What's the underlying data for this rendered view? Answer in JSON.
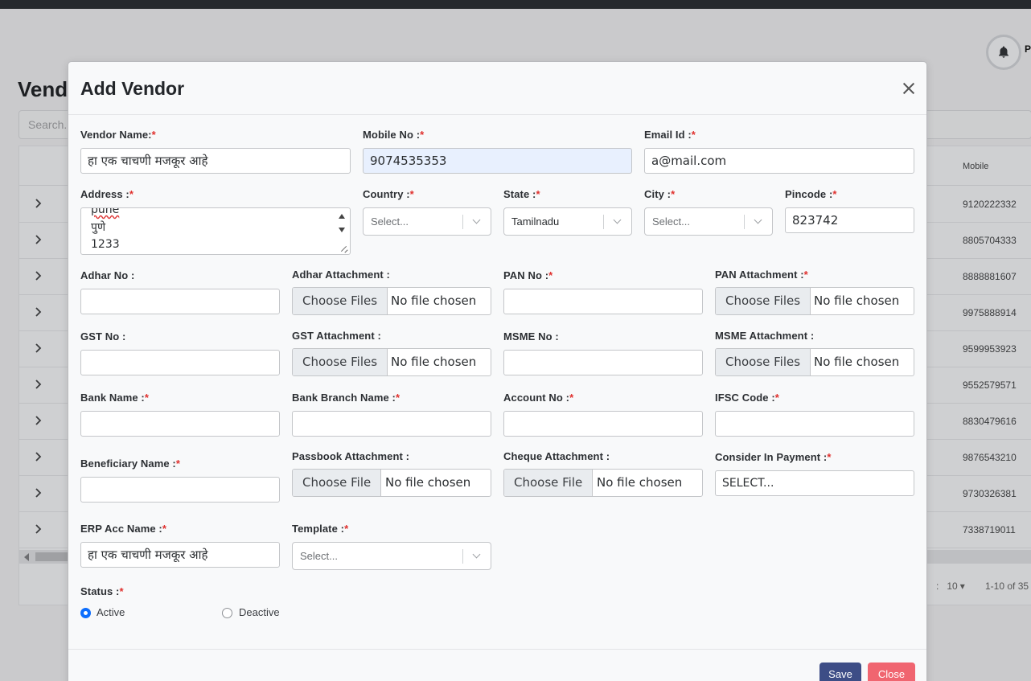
{
  "background": {
    "page_title": "Vend",
    "search_placeholder": "Search.",
    "user_initial": "P",
    "table_header_mobile": "Mobile",
    "rows": [
      {
        "mobile": "9120222332"
      },
      {
        "mobile": "8805704333"
      },
      {
        "mobile": "8888881607"
      },
      {
        "mobile": "9975888914"
      },
      {
        "mobile": "9599953923"
      },
      {
        "mobile": "9552579571"
      },
      {
        "mobile": "8830479616"
      },
      {
        "mobile": "9876543210"
      },
      {
        "mobile": "9730326381"
      },
      {
        "mobile": "7338719011"
      }
    ],
    "pager": {
      "prefix": ":",
      "page_size": "10",
      "range": "1-10 of 35"
    }
  },
  "modal": {
    "title": "Add Vendor",
    "fields": {
      "vendor_name": {
        "label": "Vendor Name:",
        "value": "हा एक चाचणी मजकूर आहे"
      },
      "mobile_no": {
        "label": "Mobile No :",
        "value": "9074535353"
      },
      "email_id": {
        "label": "Email Id :",
        "value": "a@mail.com"
      },
      "address": {
        "label": "Address :",
        "lines": [
          "pune",
          "पुणे",
          "1233"
        ]
      },
      "country": {
        "label": "Country :",
        "value": "Select..."
      },
      "state": {
        "label": "State :",
        "value": "Tamilnadu"
      },
      "city": {
        "label": "City :",
        "value": "Select..."
      },
      "pincode": {
        "label": "Pincode :",
        "value": "823742"
      },
      "adhar_no": {
        "label": "Adhar No :",
        "value": ""
      },
      "adhar_attachment": {
        "label": "Adhar Attachment :",
        "button": "Choose Files",
        "status": "No file chosen"
      },
      "pan_no": {
        "label": "PAN No :",
        "value": ""
      },
      "pan_attachment": {
        "label": "PAN Attachment :",
        "button": "Choose Files",
        "status": "No file chosen"
      },
      "gst_no": {
        "label": "GST No :",
        "value": ""
      },
      "gst_attachment": {
        "label": "GST Attachment :",
        "button": "Choose Files",
        "status": "No file chosen"
      },
      "msme_no": {
        "label": "MSME No :",
        "value": ""
      },
      "msme_attachment": {
        "label": "MSME Attachment :",
        "button": "Choose Files",
        "status": "No file chosen"
      },
      "bank_name": {
        "label": "Bank Name :",
        "value": ""
      },
      "bank_branch_name": {
        "label": "Bank Branch Name :",
        "value": ""
      },
      "account_no": {
        "label": "Account No :",
        "value": ""
      },
      "ifsc_code": {
        "label": "IFSC Code :",
        "value": ""
      },
      "beneficiary_name": {
        "label": "Beneficiary Name :",
        "value": ""
      },
      "passbook_attachment": {
        "label": "Passbook Attachment :",
        "button": "Choose File",
        "status": "No file chosen"
      },
      "cheque_attachment": {
        "label": "Cheque Attachment :",
        "button": "Choose File",
        "status": "No file chosen"
      },
      "consider_in_payment": {
        "label": "Consider In Payment :",
        "value": "SELECT..."
      },
      "erp_acc_name": {
        "label": "ERP Acc Name :",
        "value": "हा एक चाचणी मजकूर आहे"
      },
      "template": {
        "label": "Template :",
        "value": "Select..."
      },
      "status": {
        "label": "Status :",
        "options": [
          "Active",
          "Deactive"
        ],
        "selected": "Active"
      }
    },
    "required_mark": "*",
    "buttons": {
      "save": "Save",
      "close": "Close"
    }
  },
  "colors": {
    "required": "#e0312e",
    "save": "#3d4d86",
    "close": "#f06570",
    "radio_on": "#0d6efd",
    "autofill": "#e8f0fe"
  }
}
